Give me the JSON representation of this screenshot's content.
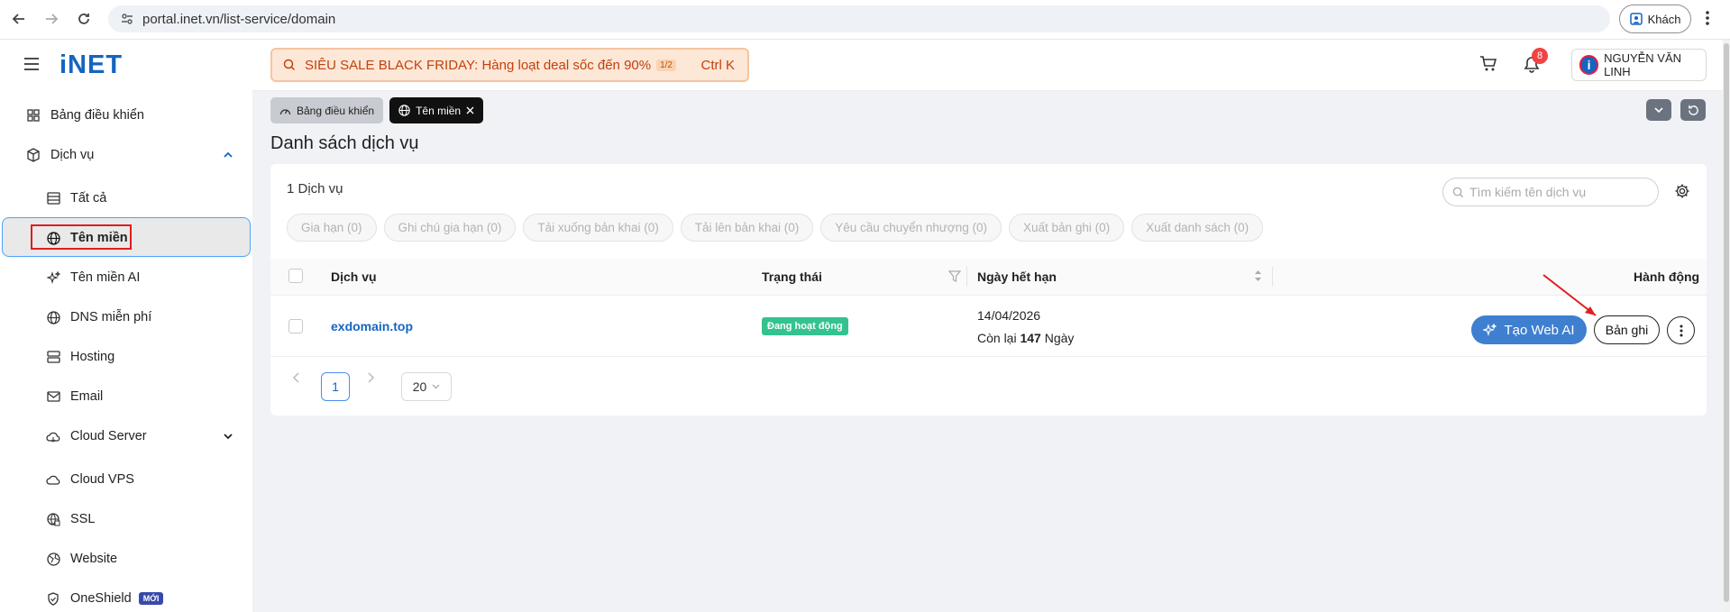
{
  "browser": {
    "url": "portal.inet.vn/list-service/domain",
    "guest_label": "Khách"
  },
  "header": {
    "logo": "iNET",
    "sale_text": "SIÊU SALE BLACK FRIDAY: Hàng loạt deal sốc đến 90%",
    "sale_page": "1/2",
    "sale_shortcut": "Ctrl K",
    "notification_count": "8",
    "user_name": "NGUYỄN VĂN LINH"
  },
  "sidebar": {
    "items": [
      {
        "label": "Bảng điều khiển",
        "icon": "dashboard-grid-icon"
      },
      {
        "label": "Dịch vụ",
        "icon": "box-icon"
      },
      {
        "label": "Tất cả",
        "icon": "list-icon"
      },
      {
        "label": "Tên miền",
        "icon": "globe-icon"
      },
      {
        "label": "Tên miền AI",
        "icon": "sparkle-icon"
      },
      {
        "label": "DNS miễn phí",
        "icon": "globe-icon"
      },
      {
        "label": "Hosting",
        "icon": "server-icon"
      },
      {
        "label": "Email",
        "icon": "mail-icon"
      },
      {
        "label": "Cloud Server",
        "icon": "cloud-icon"
      },
      {
        "label": "Cloud VPS",
        "icon": "cloud-icon"
      },
      {
        "label": "SSL",
        "icon": "ssl-globe-icon"
      },
      {
        "label": "Website",
        "icon": "website-icon"
      },
      {
        "label": "OneShield",
        "icon": "shield-icon",
        "badge": "MỚI"
      }
    ]
  },
  "breadcrumb_tabs": [
    {
      "label": "Bảng điều khiển"
    },
    {
      "label": "Tên miền"
    }
  ],
  "page": {
    "title": "Danh sách dịch vụ",
    "count": "1 Dịch vụ",
    "search_placeholder": "Tìm kiếm tên dịch vụ"
  },
  "action_buttons": [
    "Gia hạn (0)",
    "Ghi chú gia hạn (0)",
    "Tải xuống bản khai (0)",
    "Tải lên bản khai (0)",
    "Yêu cầu chuyển nhượng (0)",
    "Xuất bản ghi (0)",
    "Xuất danh sách (0)"
  ],
  "table": {
    "headers": {
      "service": "Dịch vụ",
      "status": "Trạng thái",
      "expiry": "Ngày hết hạn",
      "action": "Hành động"
    },
    "rows": [
      {
        "domain": "exdomain.top",
        "status": "Đang hoạt động",
        "expiry_date": "14/04/2026",
        "remaining_prefix": "Còn lại",
        "remaining_days": "147",
        "remaining_unit": "Ngày",
        "webai_label": "Tạo Web AI",
        "records_label": "Bản ghi"
      }
    ]
  },
  "pagination": {
    "current_page": "1",
    "page_size": "20"
  },
  "colors": {
    "brand": "#1565c0",
    "status_active": "#34c38f",
    "webai_button": "#3f7fd0",
    "highlight_box": "#e11d1d"
  }
}
